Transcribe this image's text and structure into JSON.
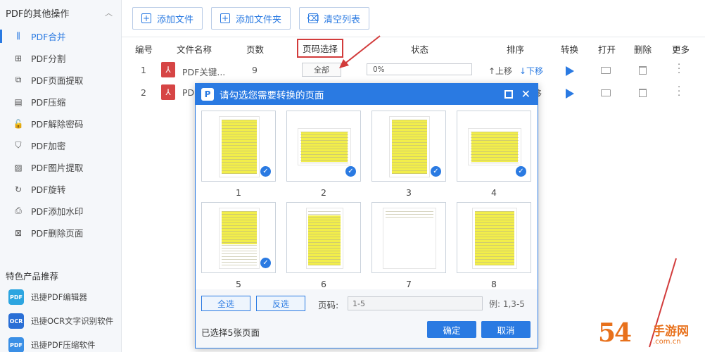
{
  "sidebar": {
    "header": "PDF的其他操作",
    "items": [
      {
        "label": "PDF合并",
        "icon": "merge-icon",
        "glyph": "⫼",
        "active": true
      },
      {
        "label": "PDF分割",
        "icon": "split-icon",
        "glyph": "⊞"
      },
      {
        "label": "PDF页面提取",
        "icon": "extract-pages-icon",
        "glyph": "⧉"
      },
      {
        "label": "PDF压缩",
        "icon": "compress-icon",
        "glyph": "▤"
      },
      {
        "label": "PDF解除密码",
        "icon": "unlock-icon",
        "glyph": "🔓"
      },
      {
        "label": "PDF加密",
        "icon": "shield-icon",
        "glyph": "⛉"
      },
      {
        "label": "PDF图片提取",
        "icon": "image-icon",
        "glyph": "▨"
      },
      {
        "label": "PDF旋转",
        "icon": "rotate-icon",
        "glyph": "↻"
      },
      {
        "label": "PDF添加水印",
        "icon": "watermark-icon",
        "glyph": "⎙"
      },
      {
        "label": "PDF删除页面",
        "icon": "delete-page-icon",
        "glyph": "⊠"
      }
    ],
    "section_title": "特色产品推荐",
    "products": [
      {
        "label": "迅捷PDF编辑器",
        "icon": "pdf-editor-icon",
        "badge": "PDF",
        "color": "#2ca5e0"
      },
      {
        "label": "迅捷OCR文字识别软件",
        "icon": "ocr-icon",
        "badge": "OCR",
        "color": "#2a6fd6"
      },
      {
        "label": "迅捷PDF压缩软件",
        "icon": "pdf-compress-icon",
        "badge": "PDF",
        "color": "#3a8fe6"
      }
    ]
  },
  "toolbar": {
    "add_file": "添加文件",
    "add_folder": "添加文件夹",
    "clear_list": "清空列表"
  },
  "table": {
    "headers": {
      "no": "编号",
      "name": "文件名称",
      "pages": "页数",
      "page_select": "页码选择",
      "status": "状态",
      "sort": "排序",
      "convert": "转换",
      "open": "打开",
      "delete": "删除",
      "more": "更多"
    },
    "rows": [
      {
        "no": "1",
        "name": "PDF关键...",
        "pages": "9",
        "select": "全部",
        "progress": "0%",
        "up": "↑上移",
        "down": "↓下移"
      },
      {
        "no": "2",
        "name": "PD",
        "up_tail": "移"
      }
    ]
  },
  "dialog": {
    "title": "请勾选您需要转换的页面",
    "pages": [
      {
        "num": "1",
        "checked": true
      },
      {
        "num": "2",
        "checked": true
      },
      {
        "num": "3",
        "checked": true
      },
      {
        "num": "4",
        "checked": true
      },
      {
        "num": "5",
        "checked": true
      },
      {
        "num": "6",
        "checked": false
      },
      {
        "num": "7",
        "checked": false
      },
      {
        "num": "8",
        "checked": false
      }
    ],
    "select_all": "全选",
    "invert": "反选",
    "range_label": "页码:",
    "range_value": "1-5",
    "example": "例: 1,3-5",
    "selected_text": "已选择5张页面",
    "ok": "确定",
    "cancel": "取消"
  },
  "watermark": {
    "num": "54",
    "text": "手游网",
    "sub": ".com.cn"
  },
  "colors": {
    "accent": "#2a7ae2",
    "highlight_box": "#d23b3b",
    "pdf_red": "#d64545",
    "watermark": "#e8711c"
  }
}
